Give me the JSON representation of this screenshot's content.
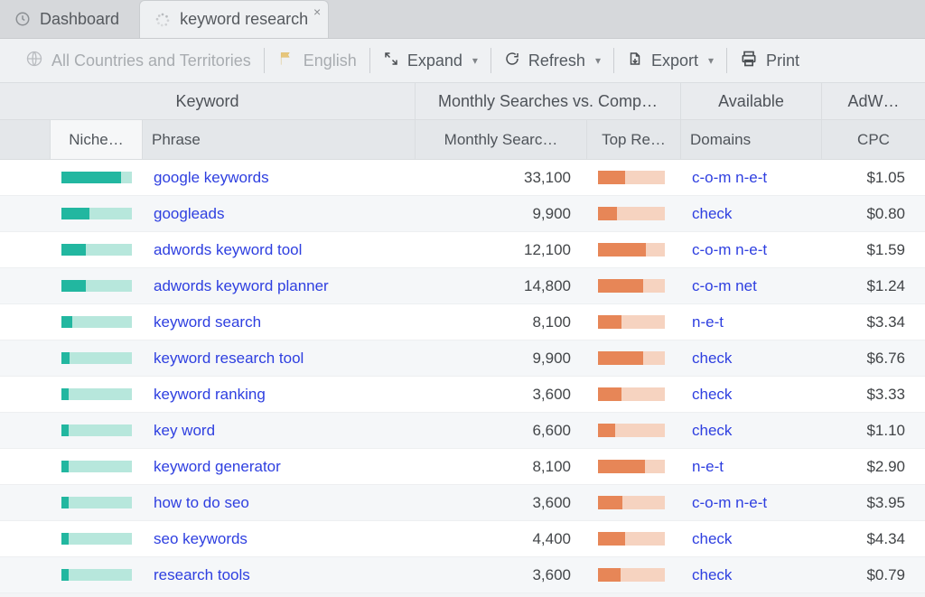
{
  "tabs": [
    {
      "label": "Dashboard",
      "icon": "clock-icon",
      "active": false
    },
    {
      "label": "keyword research",
      "icon": "spinner-icon",
      "active": true,
      "closable": true
    }
  ],
  "toolbar": {
    "country_label": "All Countries and Territories",
    "language_label": "English",
    "expand_label": "Expand",
    "refresh_label": "Refresh",
    "export_label": "Export",
    "print_label": "Print"
  },
  "header_groups": {
    "keyword": "Keyword",
    "ms_vs_comp": "Monthly Searches vs. Comp…",
    "available": "Available",
    "adwords": "AdW…"
  },
  "columns": {
    "blank": "",
    "niche": "Niche…",
    "phrase": "Phrase",
    "monthly_searches": "Monthly Searc…",
    "top_results": "Top Re…",
    "domains": "Domains",
    "cpc": "CPC"
  },
  "rows": [
    {
      "niche_pct": 85,
      "phrase": "google keywords",
      "monthly_searches": "33,100",
      "top_pct": 40,
      "domains": "c-o-m n-e-t",
      "cpc": "$1.05"
    },
    {
      "niche_pct": 40,
      "phrase": "googleads",
      "monthly_searches": "9,900",
      "top_pct": 28,
      "domains": "check",
      "cpc": "$0.80"
    },
    {
      "niche_pct": 35,
      "phrase": "adwords keyword tool",
      "monthly_searches": "12,100",
      "top_pct": 72,
      "domains": "c-o-m n-e-t",
      "cpc": "$1.59"
    },
    {
      "niche_pct": 35,
      "phrase": "adwords keyword planner",
      "monthly_searches": "14,800",
      "top_pct": 68,
      "domains": "c-o-m net",
      "cpc": "$1.24"
    },
    {
      "niche_pct": 15,
      "phrase": "keyword search",
      "monthly_searches": "8,100",
      "top_pct": 35,
      "domains": "n-e-t",
      "cpc": "$3.34"
    },
    {
      "niche_pct": 12,
      "phrase": "keyword research tool",
      "monthly_searches": "9,900",
      "top_pct": 68,
      "domains": "check",
      "cpc": "$6.76"
    },
    {
      "niche_pct": 10,
      "phrase": "keyword ranking",
      "monthly_searches": "3,600",
      "top_pct": 35,
      "domains": "check",
      "cpc": "$3.33"
    },
    {
      "niche_pct": 10,
      "phrase": "key word",
      "monthly_searches": "6,600",
      "top_pct": 26,
      "domains": "check",
      "cpc": "$1.10"
    },
    {
      "niche_pct": 10,
      "phrase": "keyword generator",
      "monthly_searches": "8,100",
      "top_pct": 70,
      "domains": "n-e-t",
      "cpc": "$2.90"
    },
    {
      "niche_pct": 10,
      "phrase": "how to do seo",
      "monthly_searches": "3,600",
      "top_pct": 36,
      "domains": "c-o-m n-e-t",
      "cpc": "$3.95"
    },
    {
      "niche_pct": 10,
      "phrase": "seo keywords",
      "monthly_searches": "4,400",
      "top_pct": 40,
      "domains": "check",
      "cpc": "$4.34"
    },
    {
      "niche_pct": 10,
      "phrase": "research tools",
      "monthly_searches": "3,600",
      "top_pct": 34,
      "domains": "check",
      "cpc": "$0.79"
    }
  ]
}
